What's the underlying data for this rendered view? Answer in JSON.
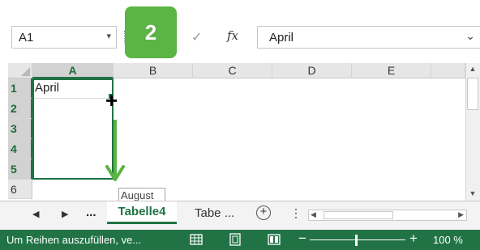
{
  "step_badge": "2",
  "formula_bar": {
    "name_box": "A1",
    "dropdown_glyph": "▾",
    "check_glyph": "✓",
    "fx_label": "fx",
    "value": "April",
    "expand_glyph": "⌄"
  },
  "grid": {
    "columns": [
      "A",
      "B",
      "C",
      "D",
      "E"
    ],
    "rows": [
      "1",
      "2",
      "3",
      "4",
      "5",
      "6"
    ],
    "cells": {
      "A1": "April"
    },
    "tooltip": "August"
  },
  "scrollbar": {
    "up": "▲",
    "down": "▼"
  },
  "sheet_tabs": {
    "prev": "◀",
    "next": "▶",
    "more": "...",
    "active": "Tabelle4",
    "other": "Tabe ...",
    "add": "+",
    "separator": "⋮",
    "scroll_left": "◀",
    "scroll_right": "▶"
  },
  "status_bar": {
    "message": "Um Reihen auszufüllen, ve...",
    "zoom_minus": "−",
    "zoom_plus": "+",
    "zoom_level": "100 %",
    "zoom_fraction": 0.48
  },
  "colors": {
    "excel_green": "#217346",
    "badge_green": "#5bb445",
    "arrow_green": "#59b443"
  }
}
